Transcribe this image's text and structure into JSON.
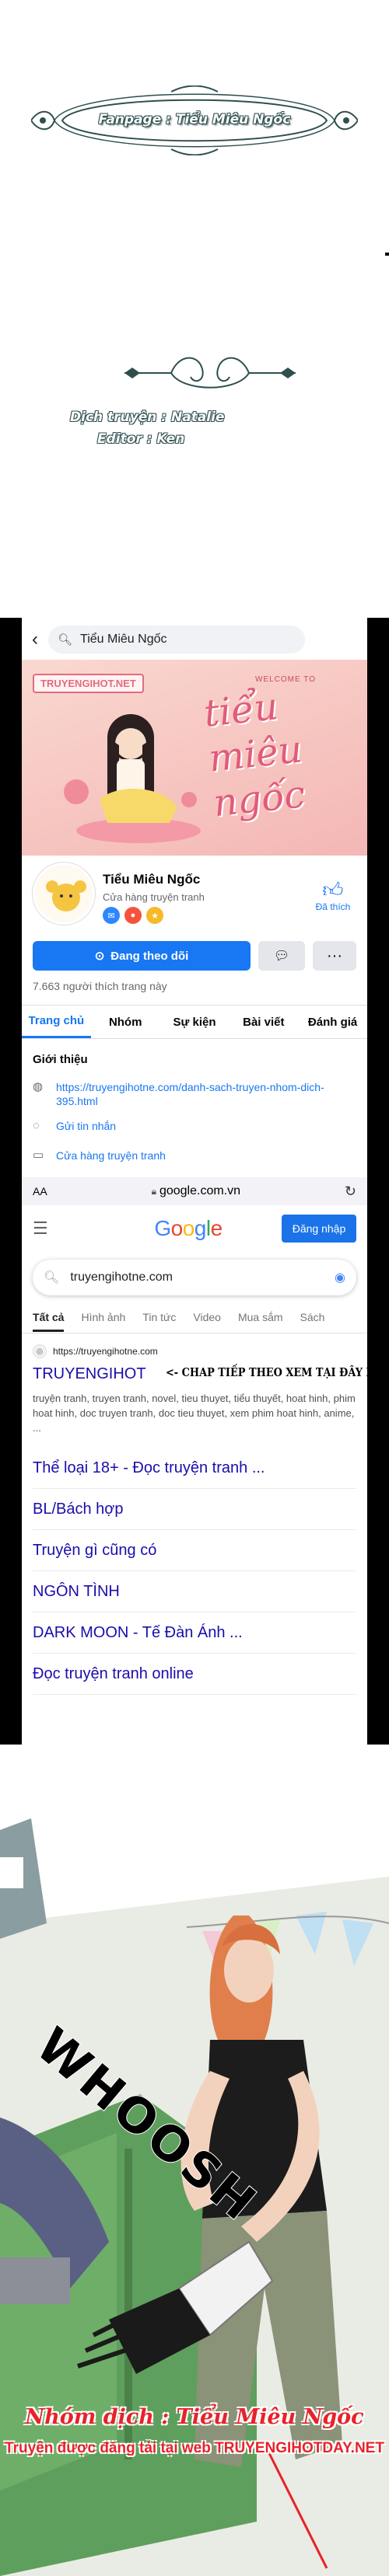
{
  "header": {
    "fanpage_text": "Fanpage : Tiểu Miêu Ngốc",
    "translator_line": "Dịch truyện : Natalie",
    "editor_line": "Editor : Ken"
  },
  "facebook": {
    "search_query": "Tiểu Miêu Ngốc",
    "cover_site_label": "TRUYENGIHOT.NET",
    "cover_welcome": "WELCOME TO",
    "cover_title": "tiểu miêu ngốc",
    "page_name": "Tiểu Miêu Ngốc",
    "page_category": "Cửa hàng truyện tranh",
    "liked_label": "Đã thích",
    "follow_button": "Đang theo dõi",
    "likes_count": "7.663 người thích trang này",
    "tabs": [
      "Trang chủ",
      "Nhóm",
      "Sự kiện",
      "Bài viết",
      "Đánh giá"
    ],
    "intro_title": "Giới thiệu",
    "intro_link": "https://truyengihotne.com/danh-sach-truyen-nhom-dich-395.html",
    "intro_message": "Gửi tin nhắn",
    "intro_category": "Cửa hàng truyện tranh"
  },
  "browser": {
    "aa_label": "AA",
    "url": "google.com.vn"
  },
  "google": {
    "logo": "Google",
    "signin_button": "Đăng nhập",
    "query": "truyengihotne.com",
    "tabs": [
      "Tất cả",
      "Hình ảnh",
      "Tin tức",
      "Video",
      "Mua sắm",
      "Sách"
    ],
    "result_url": "https://truyengihotne.com",
    "result_title": "TRUYENGIHOT",
    "result_overlay": "<- CHAP TIẾP THEO XEM TẠI ĐÂY NHA",
    "result_snippet": "truyện tranh, truyen tranh, novel, tieu thuyet, tiểu thuyết, hoat hinh, phim hoat hinh, doc truyen tranh, doc tieu thuyet, xem phim hoat hinh, anime, ...",
    "sublinks": [
      "Thể loại 18+ - Đọc truyện tranh ...",
      "BL/Bách hợp",
      "Truyện gì cũng có",
      "NGÔN TÌNH",
      "DARK MOON - Tế Đàn Ánh ...",
      "Đọc truyện tranh online"
    ]
  },
  "comic": {
    "sfx": "WHOOSH",
    "group_credit": "Nhóm dịch : Tiểu Miêu Ngốc",
    "site_credit": "Truyện được đăng tải tại web TRUYENGIHOTDAY.NET"
  },
  "colors": {
    "facebook_blue": "#1877f2",
    "google_link": "#1a0dab",
    "credit_red": "#e8222a",
    "ornament_green": "#2f4f4f"
  }
}
